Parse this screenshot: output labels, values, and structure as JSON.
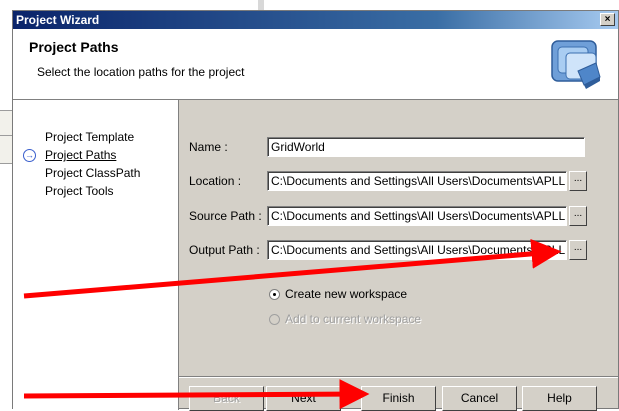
{
  "window": {
    "title": "Project Wizard",
    "close_label": "×"
  },
  "header": {
    "title": "Project Paths",
    "subtitle": "Select the location paths for the project",
    "icon": "wizard-workspace-icon"
  },
  "nav": {
    "items": [
      {
        "label": "Project Template"
      },
      {
        "label": "Project Paths",
        "current": true
      },
      {
        "label": "Project ClassPath"
      },
      {
        "label": "Project Tools"
      }
    ]
  },
  "form": {
    "name_label": "Name :",
    "name_value": "GridWorld",
    "location_label": "Location :",
    "location_value": "C:\\Documents and Settings\\All Users\\Documents\\APLL",
    "source_label": "Source Path :",
    "source_value": "C:\\Documents and Settings\\All Users\\Documents\\APLL",
    "output_label": "Output Path :",
    "output_value": "C:\\Documents and Settings\\All Users\\Documents\\APLL",
    "browse_label": "..."
  },
  "workspace": {
    "create_label": "Create new workspace",
    "add_label": "Add to current workspace"
  },
  "buttons": {
    "back": "Back",
    "next": "Next",
    "finish": "Finish",
    "cancel": "Cancel",
    "help": "Help"
  },
  "colors": {
    "arrow": "#ff0000",
    "titlebar": "#0a246a"
  }
}
